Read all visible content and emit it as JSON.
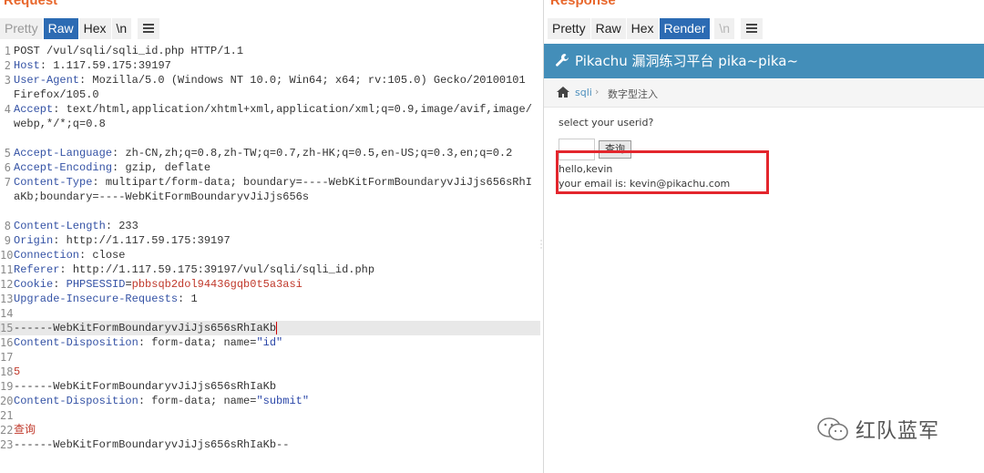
{
  "request": {
    "title": "Request",
    "tabs": [
      "Pretty",
      "Raw",
      "Hex",
      "\\n"
    ],
    "lines": [
      {
        "n": "1",
        "text": "POST /vul/sqli/sqli_id.php HTTP/1.1"
      },
      {
        "n": "2",
        "key": "Host",
        "val": "1.117.59.175:39197"
      },
      {
        "n": "3",
        "key": "User-Agent",
        "val": "Mozilla/5.0 (Windows NT 10.0; Win64; x64; rv:105.0) Gecko/20100101 Firefox/105.0"
      },
      {
        "n": "4",
        "key": "Accept",
        "val": "text/html,application/xhtml+xml,application/xml;q=0.9,image/avif,image/webp,*/*;q=0.8"
      },
      {
        "n": "5",
        "key": "Accept-Language",
        "val": "zh-CN,zh;q=0.8,zh-TW;q=0.7,zh-HK;q=0.5,en-US;q=0.3,en;q=0.2"
      },
      {
        "n": "6",
        "key": "Accept-Encoding",
        "val": "gzip, deflate"
      },
      {
        "n": "7",
        "key": "Content-Type",
        "val": "multipart/form-data; boundary=----WebKitFormBoundaryvJiJjs656sRhIaKb;boundary=----WebKitFormBoundaryvJiJjs656s"
      },
      {
        "n": "8",
        "key": "Content-Length",
        "val": "233"
      },
      {
        "n": "9",
        "key": "Origin",
        "val": "http://1.117.59.175:39197"
      },
      {
        "n": "10",
        "key": "Connection",
        "val": "close"
      },
      {
        "n": "11",
        "key": "Referer",
        "val": "http://1.117.59.175:39197/vul/sqli/sqli_id.php"
      },
      {
        "n": "12",
        "key": "Cookie",
        "cookie_name": "PHPSESSID",
        "cookie_val": "pbbsqb2dol94436gqb0t5a3asi"
      },
      {
        "n": "13",
        "key": "Upgrade-Insecure-Requests",
        "val": "1"
      },
      {
        "n": "14",
        "text": ""
      },
      {
        "n": "15",
        "text": "------WebKitFormBoundaryvJiJjs656sRhIaKb"
      },
      {
        "n": "16",
        "key": "Content-Disposition",
        "val": "form-data; name=",
        "quoted": "\"id\""
      },
      {
        "n": "17",
        "text": ""
      },
      {
        "n": "18",
        "body": "5"
      },
      {
        "n": "19",
        "text": "------WebKitFormBoundaryvJiJjs656sRhIaKb"
      },
      {
        "n": "20",
        "key": "Content-Disposition",
        "val": "form-data; name=",
        "quoted": "\"submit\""
      },
      {
        "n": "21",
        "text": ""
      },
      {
        "n": "22",
        "body": "查询"
      },
      {
        "n": "23",
        "text": "------WebKitFormBoundaryvJiJjs656sRhIaKb--"
      }
    ]
  },
  "response": {
    "title": "Response",
    "tabs": [
      "Pretty",
      "Raw",
      "Hex",
      "Render",
      "\\n"
    ],
    "app_title": "Pikachu 漏洞练习平台 pika~pika~",
    "crumb_link": "sqli",
    "crumb_current": "数字型注入",
    "select_label": "select your userid?",
    "button_label": "查询",
    "result_line1": "hello,kevin",
    "result_line2": "your email is: kevin@pikachu.com"
  },
  "watermark": "红队蓝军",
  "colors": {
    "accent": "#2c6bb3",
    "title_orange": "#e8672c",
    "app_header": "#438eb9",
    "annotation_red": "#e3262d"
  }
}
